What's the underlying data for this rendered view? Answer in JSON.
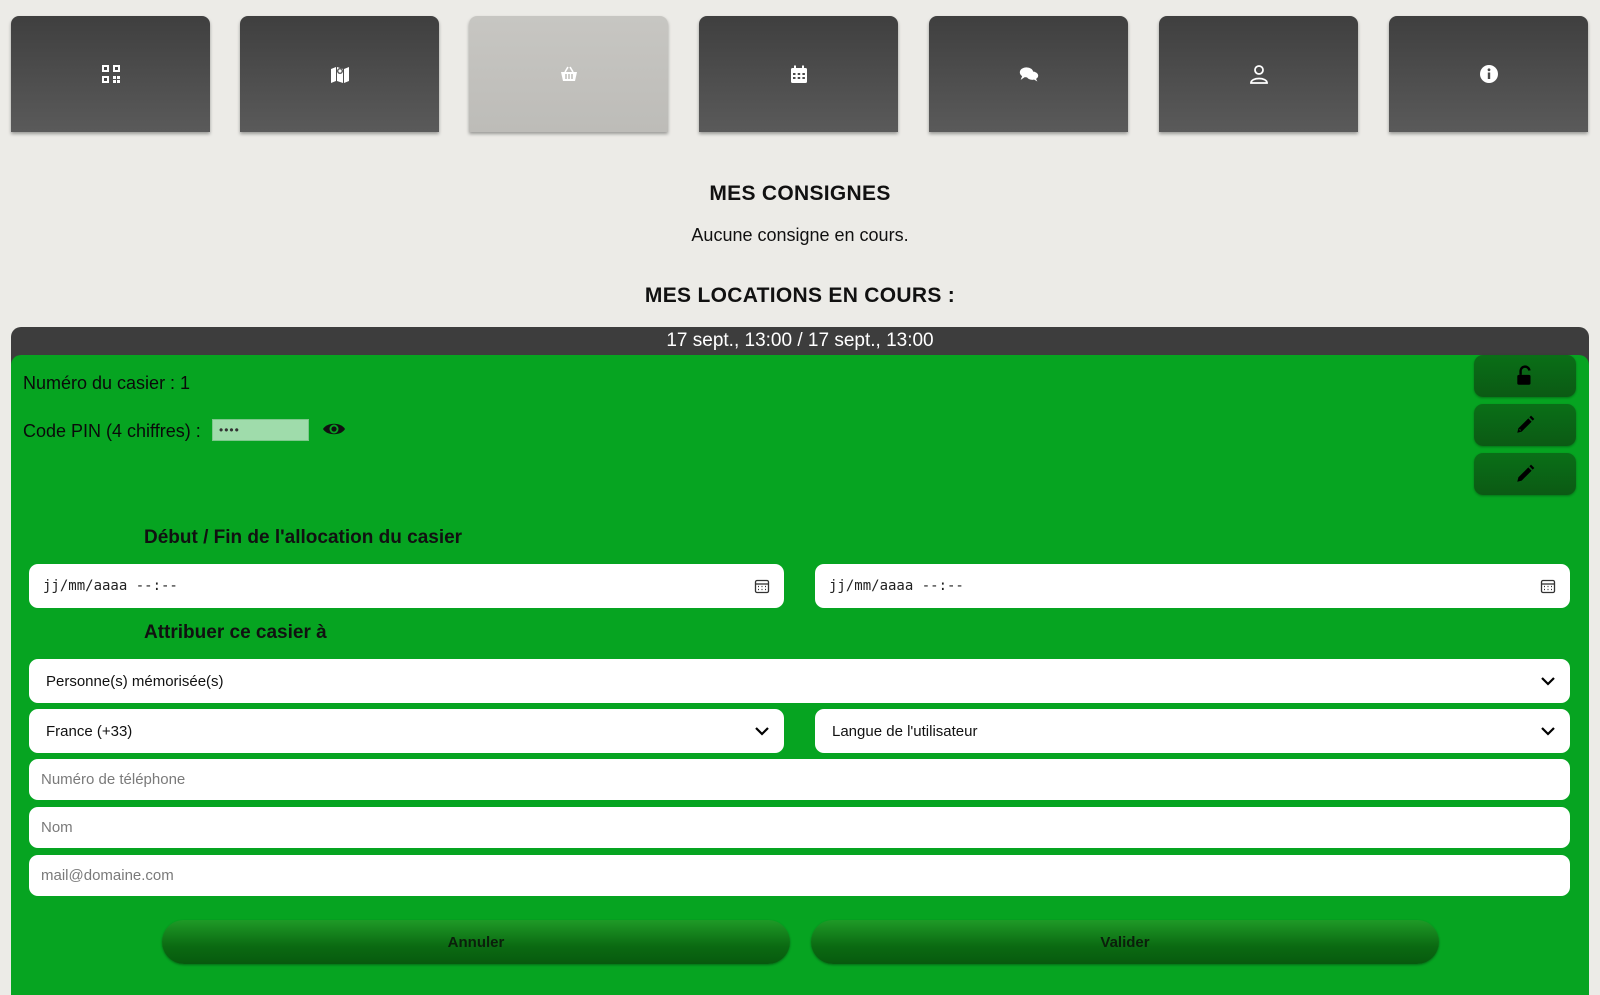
{
  "nav": {
    "items": [
      {
        "icon": "qrcode-icon"
      },
      {
        "icon": "map-icon"
      },
      {
        "icon": "basket-icon",
        "active": true
      },
      {
        "icon": "calendar-icon"
      },
      {
        "icon": "chat-icon"
      },
      {
        "icon": "user-icon"
      },
      {
        "icon": "info-icon"
      }
    ]
  },
  "consignes": {
    "title": "MES CONSIGNES",
    "empty_text": "Aucune consigne en cours."
  },
  "locations": {
    "title": "MES LOCATIONS EN COURS :",
    "rental": {
      "dates": "17 sept., 13:00 / 17 sept., 13:00",
      "locker_label": "Numéro du casier : 1",
      "pin_label": "Code PIN (4 chiffres) :",
      "pin_value": "••••",
      "side_buttons": [
        {
          "icon": "unlock-icon"
        },
        {
          "icon": "pencil-icon"
        },
        {
          "icon": "pencil-icon"
        }
      ],
      "allocation_title": "Début / Fin de l'allocation du casier",
      "start_value": "jj/mm/aaaa --:--",
      "end_value": "jj/mm/aaaa --:--",
      "assign_title": "Attribuer ce casier à",
      "persons_select": "Personne(s) mémorisée(s)",
      "country_select": "France (+33)",
      "language_select": "Langue de l'utilisateur",
      "phone_placeholder": "Numéro de téléphone",
      "name_placeholder": "Nom",
      "email_placeholder": "mail@domaine.com",
      "cancel_label": "Annuler",
      "validate_label": "Valider"
    }
  },
  "colors": {
    "card_green": "#06a421",
    "dark_button": "#0b5a14",
    "nav_dark": "#4a4a4a",
    "nav_active": "#c2c1bd"
  }
}
